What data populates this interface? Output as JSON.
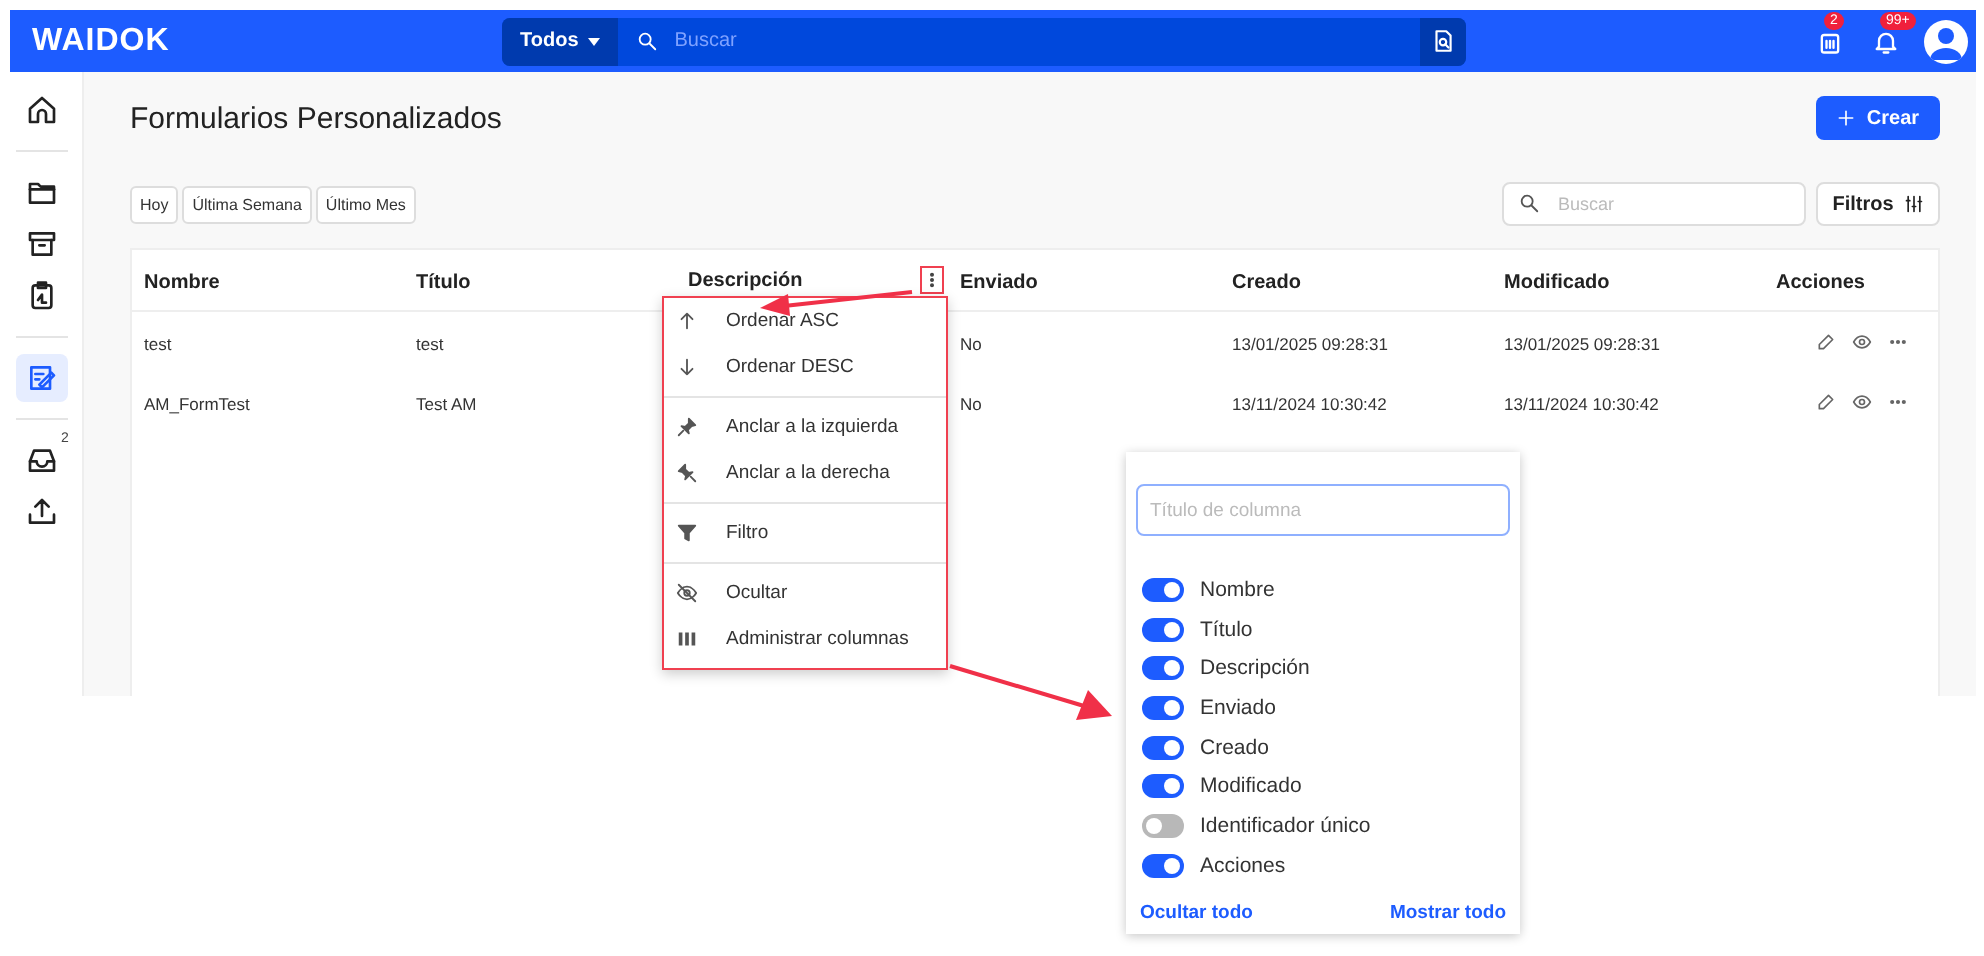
{
  "header": {
    "logo": "WAIDOK",
    "scope": "Todos",
    "search_placeholder": "Buscar",
    "notifications": [
      {
        "kind": "tasks",
        "badge": "2"
      },
      {
        "kind": "bell",
        "badge": "99+"
      }
    ]
  },
  "sidebar": {
    "items": [
      {
        "kind": "home",
        "selected": false
      },
      {
        "kind": "folder",
        "selected": false
      },
      {
        "kind": "archive",
        "selected": false
      },
      {
        "kind": "clipboard",
        "selected": false
      },
      {
        "kind": "forms",
        "selected": true
      },
      {
        "kind": "inbox",
        "selected": false,
        "badge": "2"
      },
      {
        "kind": "upload",
        "selected": false
      }
    ]
  },
  "page": {
    "title": "Formularios Personalizados",
    "create_button": "Crear",
    "date_filters": [
      "Hoy",
      "Última Semana",
      "Último Mes"
    ],
    "search_placeholder": "Buscar",
    "filters_button": "Filtros"
  },
  "table": {
    "columns": [
      {
        "label": "Nombre",
        "menu_open": false
      },
      {
        "label": "Título",
        "menu_open": false
      },
      {
        "label": "Descripción",
        "menu_open": true
      },
      {
        "label": "Enviado",
        "menu_open": false
      },
      {
        "label": "Creado",
        "menu_open": false
      },
      {
        "label": "Modificado",
        "menu_open": false
      },
      {
        "label": "Acciones",
        "menu_open": false
      }
    ],
    "rows": [
      {
        "nombre": "test",
        "titulo": "test",
        "enviado": "No",
        "creado": "13/01/2025 09:28:31",
        "modificado": "13/01/2025 09:28:31"
      },
      {
        "nombre": "AM_FormTest",
        "titulo": "Test AM",
        "enviado": "No",
        "creado": "13/11/2024 10:30:42",
        "modificado": "13/11/2024 10:30:42"
      }
    ]
  },
  "column_menu": {
    "sections": [
      {
        "items": [
          {
            "kind": "sort-asc",
            "label": "Ordenar ASC"
          },
          {
            "kind": "sort-desc",
            "label": "Ordenar DESC"
          }
        ]
      },
      {
        "items": [
          {
            "kind": "pin-left",
            "label": "Anclar a la izquierda"
          },
          {
            "kind": "pin-right",
            "label": "Anclar a la derecha"
          }
        ]
      },
      {
        "items": [
          {
            "kind": "filter",
            "label": "Filtro"
          }
        ]
      },
      {
        "items": [
          {
            "kind": "hide",
            "label": "Ocultar"
          },
          {
            "kind": "columns",
            "label": "Administrar columnas"
          }
        ]
      }
    ]
  },
  "column_manager": {
    "placeholder": "Título de columna",
    "columns": [
      {
        "label": "Nombre",
        "on": true
      },
      {
        "label": "Título",
        "on": true
      },
      {
        "label": "Descripción",
        "on": true
      },
      {
        "label": "Enviado",
        "on": true
      },
      {
        "label": "Creado",
        "on": true
      },
      {
        "label": "Modificado",
        "on": true
      },
      {
        "label": "Identificador único",
        "on": false
      },
      {
        "label": "Acciones",
        "on": true
      }
    ],
    "hide_all": "Ocultar todo",
    "show_all": "Mostrar todo"
  }
}
